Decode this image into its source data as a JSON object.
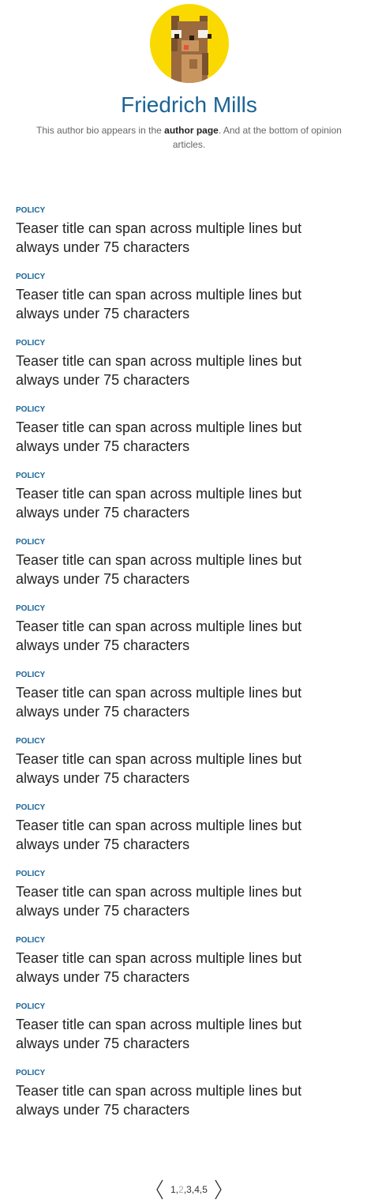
{
  "author": {
    "name": "Friedrich Mills",
    "bio_prefix": "This author bio appears in the ",
    "bio_link": "author page",
    "bio_suffix": ". And at the bottom of opinion articles.",
    "avatar_icon": "pixel-bear-icon",
    "avatar_background": "#f9d900"
  },
  "teasers": [
    {
      "category": "POLICY",
      "title": "Teaser title can span across multiple lines but always under 75 characters"
    },
    {
      "category": "POLICY",
      "title": "Teaser title can span across multiple lines but always under 75 characters"
    },
    {
      "category": "POLICY",
      "title": "Teaser title can span across multiple lines but always under 75 characters"
    },
    {
      "category": "POLICY",
      "title": "Teaser title can span across multiple lines but always under 75 characters"
    },
    {
      "category": "POLICY",
      "title": "Teaser title can span across multiple lines but always under 75 characters"
    },
    {
      "category": "POLICY",
      "title": "Teaser title can span across multiple lines but always under 75 characters"
    },
    {
      "category": "POLICY",
      "title": "Teaser title can span across multiple lines but always under 75 characters"
    },
    {
      "category": "POLICY",
      "title": "Teaser title can span across multiple lines but always under 75 characters"
    },
    {
      "category": "POLICY",
      "title": "Teaser title can span across multiple lines but always under 75 characters"
    },
    {
      "category": "POLICY",
      "title": "Teaser title can span across multiple lines but always under 75 characters"
    },
    {
      "category": "POLICY",
      "title": "Teaser title can span across multiple lines but always under 75 characters"
    },
    {
      "category": "POLICY",
      "title": "Teaser title can span across multiple lines but always under 75 characters"
    },
    {
      "category": "POLICY",
      "title": "Teaser title can span across multiple lines but always under 75 characters"
    },
    {
      "category": "POLICY",
      "title": "Teaser title can span across multiple lines but always under 75 characters"
    }
  ],
  "pagination": {
    "prev_icon": "chevron-left-icon",
    "next_icon": "chevron-right-icon",
    "pages": [
      "1",
      "2",
      "3",
      "4",
      "5"
    ],
    "current": "2",
    "separator": ","
  },
  "colors": {
    "accent": "#1a6496",
    "text": "#222222",
    "muted": "#666666",
    "current_page": "#aaaaaa"
  }
}
